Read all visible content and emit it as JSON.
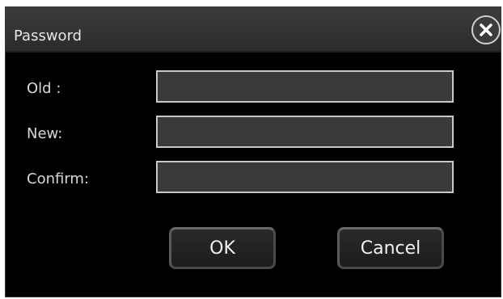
{
  "dialog": {
    "title": "Password",
    "close_icon": "close-icon"
  },
  "form": {
    "old_label": "Old :",
    "old_value": "",
    "new_label": "New:",
    "new_value": "",
    "confirm_label": "Confirm:",
    "confirm_value": ""
  },
  "buttons": {
    "ok_label": "OK",
    "cancel_label": "Cancel"
  },
  "colors": {
    "background": "#000000",
    "titlebar": "#333333",
    "field_fill": "#3a3a3a",
    "field_border": "#c8c8c8",
    "text": "#e6e6e6"
  }
}
